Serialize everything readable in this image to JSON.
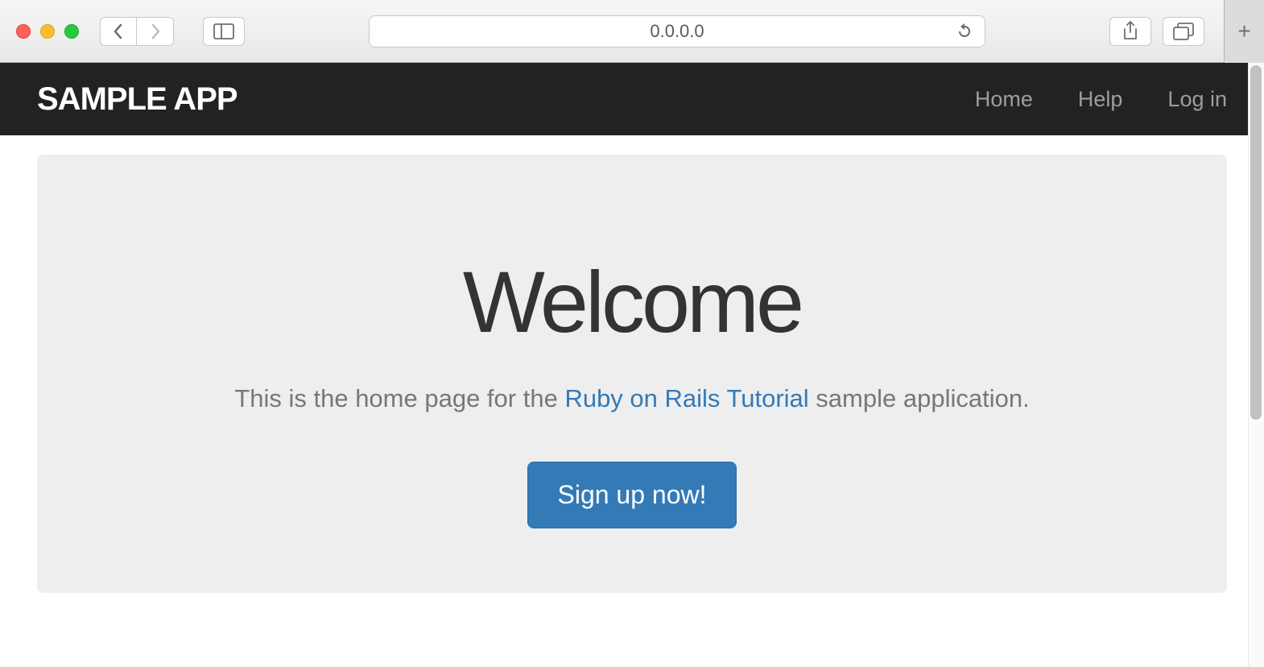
{
  "browser": {
    "url": "0.0.0.0"
  },
  "navbar": {
    "brand": "SAMPLE APP",
    "links": {
      "home": "Home",
      "help": "Help",
      "login": "Log in"
    }
  },
  "hero": {
    "heading": "Welcome",
    "subtext_prefix": "This is the home page for the ",
    "subtext_link": "Ruby on Rails Tutorial",
    "subtext_suffix": " sample application.",
    "signup_button": "Sign up now!"
  }
}
